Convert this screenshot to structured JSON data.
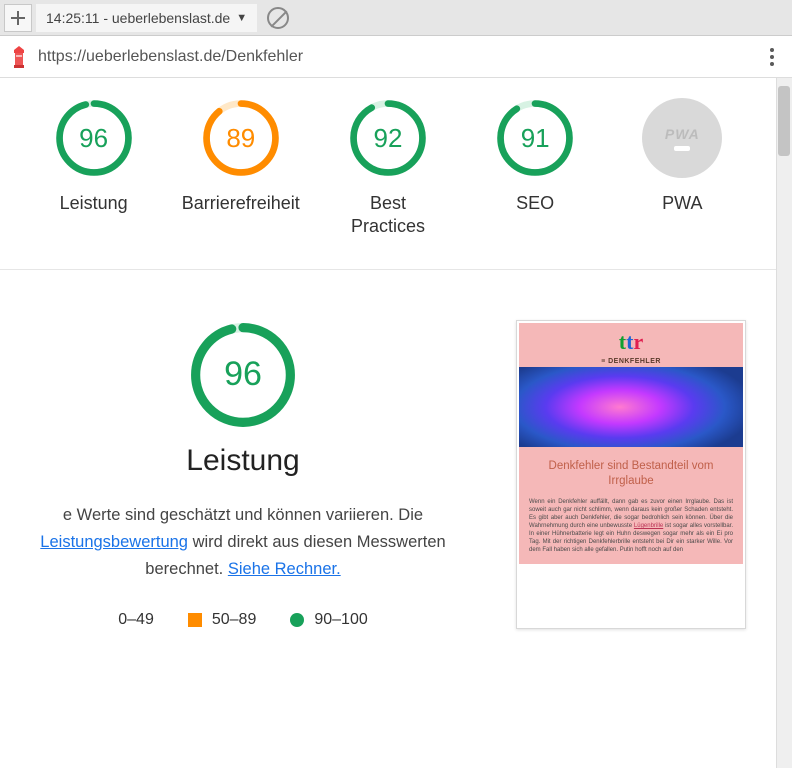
{
  "tabbar": {
    "tab_title": "14:25:11 - ueberlebenslast.de"
  },
  "urlbar": {
    "url": "https://ueberlebenslast.de/Denkfehler"
  },
  "colors": {
    "green": "#18a15a",
    "green_bg": "#d7f2e3",
    "orange": "#ff8c00",
    "orange_bg": "#ffe8c7"
  },
  "gauges": [
    {
      "score": 96,
      "label": "Leistung",
      "color": "green"
    },
    {
      "score": 89,
      "label": "Barrierefreiheit",
      "color": "orange"
    },
    {
      "score": 92,
      "label": "Best Practices",
      "color": "green"
    },
    {
      "score": 91,
      "label": "SEO",
      "color": "green"
    }
  ],
  "pwa": {
    "label": "PWA",
    "badge": "PWA"
  },
  "detail": {
    "score": 96,
    "heading": "Leistung",
    "desc_pre": "e Werte sind geschätzt und können variieren. Die ",
    "link1": "Leistungsbewertung",
    "desc_mid": " wird direkt aus diesen Messwerten berechnet. ",
    "link2": "Siehe Rechner."
  },
  "legend": {
    "r1": "0–49",
    "r2": "50–89",
    "r3": "90–100"
  },
  "preview": {
    "sub": "≡ DENKFEHLER",
    "title1": "Denkfehler sind Bestandteil vom",
    "title2": "Irrglaube",
    "body_a": "Wenn ein Denkfehler auffällt, dann gab es zuvor einen Irrglaube. Das ist soweit auch gar nicht schlimm, wenn daraus kein großer Schaden entsteht. Es gibt aber auch Denkfehler, die sogar bedrohlich sein können. Über die Wahrnehmung durch eine unbewusste ",
    "body_link": "Lügenbrille",
    "body_b": " ist sogar alles vorstellbar. In einer Hühnerbatterie legt ein Huhn deswegen sogar mehr als ein Ei pro Tag. Mit der richtigen Denkfehlerbrille entsteht bei Dir ein starker Wille. Vor dem Fall haben sich alle gefallen. Putin hofft noch auf den"
  }
}
